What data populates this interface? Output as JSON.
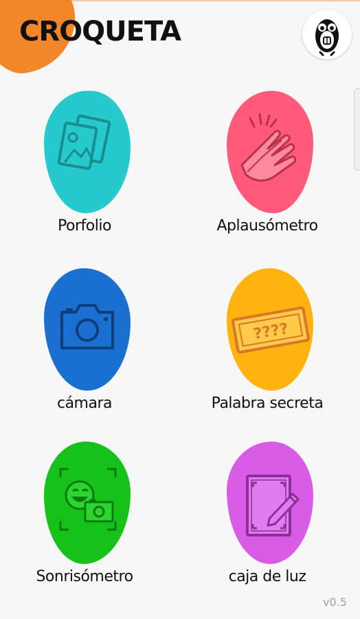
{
  "header": {
    "logo_text": "CROQUETA",
    "logo_color": "#f4862a"
  },
  "tiles": [
    {
      "label": "Porfolio",
      "color": "#26c9cc",
      "icon": "photos-icon"
    },
    {
      "label": "Aplausómetro",
      "color": "#ff5a7a",
      "icon": "clapping-hands-icon"
    },
    {
      "label": "cámara",
      "color": "#1b6fd0",
      "icon": "camera-icon"
    },
    {
      "label": "Palabra secreta",
      "color": "#ffb30f",
      "icon": "ticket-icon"
    },
    {
      "label": "Sonrisómetro",
      "color": "#16c21a",
      "icon": "smile-camera-icon"
    },
    {
      "label": "caja de luz",
      "color": "#d95ce6",
      "icon": "lightbox-pencil-icon"
    }
  ],
  "ticket_text": "????",
  "version": "v0.5"
}
